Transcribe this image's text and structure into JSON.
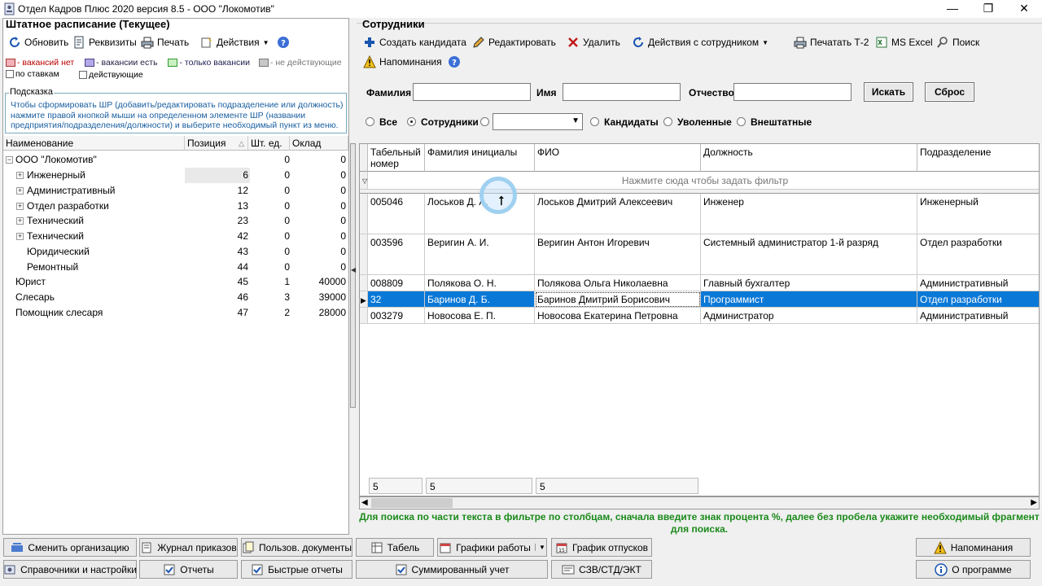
{
  "window": {
    "title": "Отдел Кадров Плюс 2020 версия 8.5 - ООО \"Локомотив\""
  },
  "left": {
    "title": "Штатное расписание (Текущее)",
    "toolbar": {
      "refresh": "Обновить",
      "requisites": "Реквизиты",
      "print": "Печать",
      "actions": "Действия"
    },
    "legend": {
      "no_vacancy": "- вакансий нет",
      "has_vacancy": "- вакансии есть",
      "only_vacancy": "- только вакансии",
      "inactive": "- не действующие",
      "by_rates": "по ставкам",
      "active": "действующие"
    },
    "hint": {
      "label": "Подсказка",
      "text": "Чтобы сформировать ШР (добавить/редактировать подразделение или должность) нажмите правой кнопкой мыши на определенном элементе ШР (названии предприятия/подразделения/должности) и выберите необходимый пункт из меню."
    },
    "columns": {
      "name": "Наименование",
      "position": "Позиция",
      "units": "Шт. ед.",
      "salary": "Оклад"
    },
    "rows": [
      {
        "name": "ООО \"Локомотив\"",
        "position": "",
        "units": "0",
        "salary": "0"
      },
      {
        "name": "Инженерный",
        "position": "6",
        "units": "0",
        "salary": "0"
      },
      {
        "name": "Административный",
        "position": "12",
        "units": "0",
        "salary": "0"
      },
      {
        "name": "Отдел разработки",
        "position": "13",
        "units": "0",
        "salary": "0"
      },
      {
        "name": "Технический",
        "position": "23",
        "units": "0",
        "salary": "0"
      },
      {
        "name": "Технический",
        "position": "42",
        "units": "0",
        "salary": "0"
      },
      {
        "name": "Юридический",
        "position": "43",
        "units": "0",
        "salary": "0"
      },
      {
        "name": "Ремонтный",
        "position": "44",
        "units": "0",
        "salary": "0"
      },
      {
        "name": "Юрист",
        "position": "45",
        "units": "1",
        "salary": "40000"
      },
      {
        "name": "Слесарь",
        "position": "46",
        "units": "3",
        "salary": "39000"
      },
      {
        "name": "Помощник слесаря",
        "position": "47",
        "units": "2",
        "salary": "28000"
      }
    ]
  },
  "right": {
    "title": "Сотрудники",
    "toolbar": {
      "create": "Создать кандидата",
      "edit": "Редактировать",
      "delete": "Удалить",
      "actions": "Действия с сотрудником",
      "print_t2": "Печатать Т-2",
      "excel": "MS Excel",
      "search": "Поиск",
      "reminders": "Напоминания"
    },
    "filter": {
      "surname": "Фамилия",
      "name": "Имя",
      "patronymic": "Отчество",
      "search_btn": "Искать",
      "reset_btn": "Сброс"
    },
    "radios": {
      "all": "Все",
      "employees": "Сотрудники",
      "candidates": "Кандидаты",
      "fired": "Уволенные",
      "external": "Внештатные"
    },
    "columns": {
      "tab": "Табельный номер",
      "initials": "Фамилия инициалы",
      "fio": "ФИО",
      "position": "Должность",
      "dept": "Подразделение"
    },
    "filter_row": "Нажмите  сюда чтобы задать фильтр",
    "rows": [
      {
        "tab": "005046",
        "initials": "Лоськов Д. А.",
        "fio": "Лоськов Дмитрий Алексеевич",
        "position": "Инженер",
        "dept": "Инженерный"
      },
      {
        "tab": "003596",
        "initials": "Веригин А. И.",
        "fio": "Веригин Антон Игоревич",
        "position": "Системный администратор 1-й разряд",
        "dept": "Отдел разработки"
      },
      {
        "tab": "008809",
        "initials": "Полякова О. Н.",
        "fio": "Полякова Ольга Николаевна",
        "position": "Главный бухгалтер",
        "dept": "Административный"
      },
      {
        "tab": "32",
        "initials": "Баринов Д. Б.",
        "fio": "Баринов Дмитрий Борисович",
        "position": "Программист",
        "dept": "Отдел разработки"
      },
      {
        "tab": "003279",
        "initials": "Новосова Е. П.",
        "fio": "Новосова Екатерина Петровна",
        "position": "Администратор",
        "dept": "Административный"
      }
    ],
    "footer": {
      "c1": "5",
      "c2": "5",
      "c3": "5"
    },
    "note": "Для поиска по части текста в фильтре по столбцам, сначала введите знак процента %, далее без пробела укажите необходимый фрагмент для поиска."
  },
  "bottom": {
    "change_org": "Сменить организацию",
    "orders": "Журнал приказов",
    "user_docs": "Пользов. документы",
    "timesheet": "Табель",
    "schedules": "Графики работы",
    "vacation": "График отпусков",
    "reminders": "Напоминания",
    "settings": "Справочники и настройки",
    "reports": "Отчеты",
    "quick_reports": "Быстрые отчеты",
    "summary": "Суммированный учет",
    "szv": "СЗВ/СТД/ЭКТ",
    "about": "О программе"
  }
}
